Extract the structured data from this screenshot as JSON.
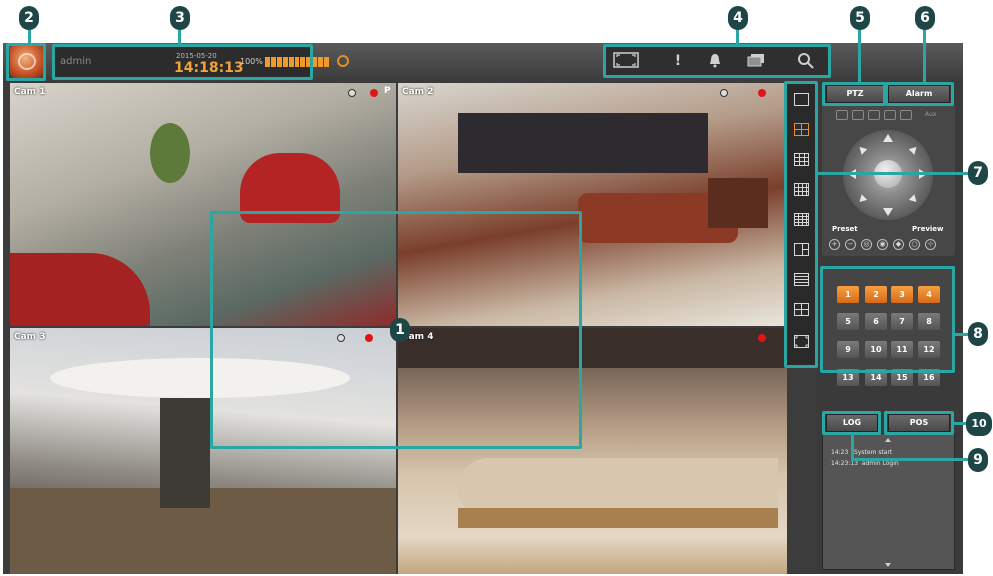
{
  "callouts": [
    "1",
    "2",
    "3",
    "4",
    "5",
    "6",
    "7",
    "8",
    "9",
    "10"
  ],
  "status": {
    "user": "admin",
    "date": "2015-05-20",
    "time": "14:18:13",
    "hdd_percent": "100%",
    "hdd_fill": 1.0
  },
  "toolbar": {
    "icons": [
      "fullscreen-icon",
      "alert-icon",
      "bell-icon",
      "backup-icon",
      "search-icon"
    ],
    "alert_glyph": "!"
  },
  "cameras": [
    {
      "label": "Cam 1",
      "p_flag": "P"
    },
    {
      "label": "Cam 2"
    },
    {
      "label": "Cam 3"
    },
    {
      "label": "Cam 4"
    }
  ],
  "layouts": {
    "count": 9,
    "active_index": 1
  },
  "ptz": {
    "tab_label": "PTZ",
    "alarm_label": "Alarm",
    "preset_label": "Preset",
    "preview_label": "Preview",
    "aux_label": "Aux",
    "controls": [
      "+",
      "−",
      "◎",
      "◉",
      "◆",
      "○",
      "⊹"
    ]
  },
  "channels": {
    "buttons": [
      "1",
      "2",
      "3",
      "4",
      "5",
      "6",
      "7",
      "8",
      "9",
      "10",
      "11",
      "12",
      "13",
      "14",
      "15",
      "16"
    ],
    "active": [
      "1",
      "2",
      "3",
      "4"
    ]
  },
  "log": {
    "log_label": "LOG",
    "pos_label": "POS",
    "entries": [
      {
        "time": "14:23",
        "text": "System start"
      },
      {
        "time": "14:23:13",
        "text": "admin Login"
      }
    ]
  },
  "colors": {
    "accent": "#2aa7a3",
    "callout_bg": "#1f4646",
    "time": "#f2a33a",
    "channel_active": "#e07a22",
    "rec": "#e01515"
  }
}
